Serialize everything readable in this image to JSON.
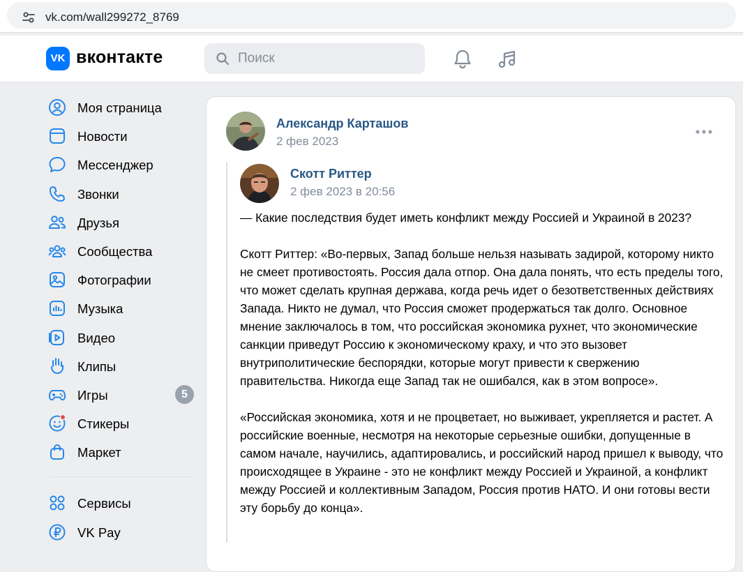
{
  "browser": {
    "url": "vk.com/wall299272_8769"
  },
  "header": {
    "logo_text": "VK",
    "brand": "вконтакте",
    "search_placeholder": "Поиск",
    "accent_color": "#0077ff"
  },
  "menu": {
    "items": [
      {
        "label": "Моя страница",
        "icon": "profile-icon"
      },
      {
        "label": "Новости",
        "icon": "news-icon"
      },
      {
        "label": "Мессенджер",
        "icon": "messenger-icon"
      },
      {
        "label": "Звонки",
        "icon": "phone-icon"
      },
      {
        "label": "Друзья",
        "icon": "friends-icon"
      },
      {
        "label": "Сообщества",
        "icon": "communities-icon"
      },
      {
        "label": "Фотографии",
        "icon": "photos-icon"
      },
      {
        "label": "Музыка",
        "icon": "music-icon"
      },
      {
        "label": "Видео",
        "icon": "video-icon"
      },
      {
        "label": "Клипы",
        "icon": "clips-icon"
      },
      {
        "label": "Игры",
        "icon": "games-icon",
        "badge": "5"
      },
      {
        "label": "Стикеры",
        "icon": "stickers-icon"
      },
      {
        "label": "Маркет",
        "icon": "market-icon"
      }
    ],
    "extra_items": [
      {
        "label": "Сервисы",
        "icon": "services-icon"
      },
      {
        "label": "VK Pay",
        "icon": "vkpay-icon"
      }
    ]
  },
  "post": {
    "author": "Александр Карташов",
    "date": "2 фев 2023",
    "repost": {
      "author": "Скотт Риттер",
      "date": "2 фев 2023 в 20:56",
      "paragraphs": [
        "— Какие последствия будет иметь конфликт между Россией и Украиной в 2023?",
        "Скотт Риттер: «Во-первых, Запад больше нельзя называть задирой, которому никто не смеет противостоять. Россия дала отпор. Она дала понять, что есть пределы того, что может сделать крупная держава, когда речь идет о безответственных действиях Запада. Никто не думал, что Россия сможет продержаться так долго. Основное мнение заключалось в том, что российская экономика рухнет, что экономические санкции приведут Россию к экономическому краху, и что это вызовет внутриполитические беспорядки, которые могут привести к свержению правительства. Никогда еще Запад так не ошибался, как в этом вопросе».",
        "«Российская экономика, хотя и не процветает, но выживает, укрепляется и растет. А российские военные, несмотря на некоторые серьезные ошибки, допущенные в самом начале, научились, адаптировались, и российский народ пришел к выводу, что происходящее в Украине - это не конфликт между Россией и Украиной, а конфликт между Россией и коллективным Западом, Россия против НАТО. И они готовы вести эту борьбу до конца»."
      ]
    }
  }
}
